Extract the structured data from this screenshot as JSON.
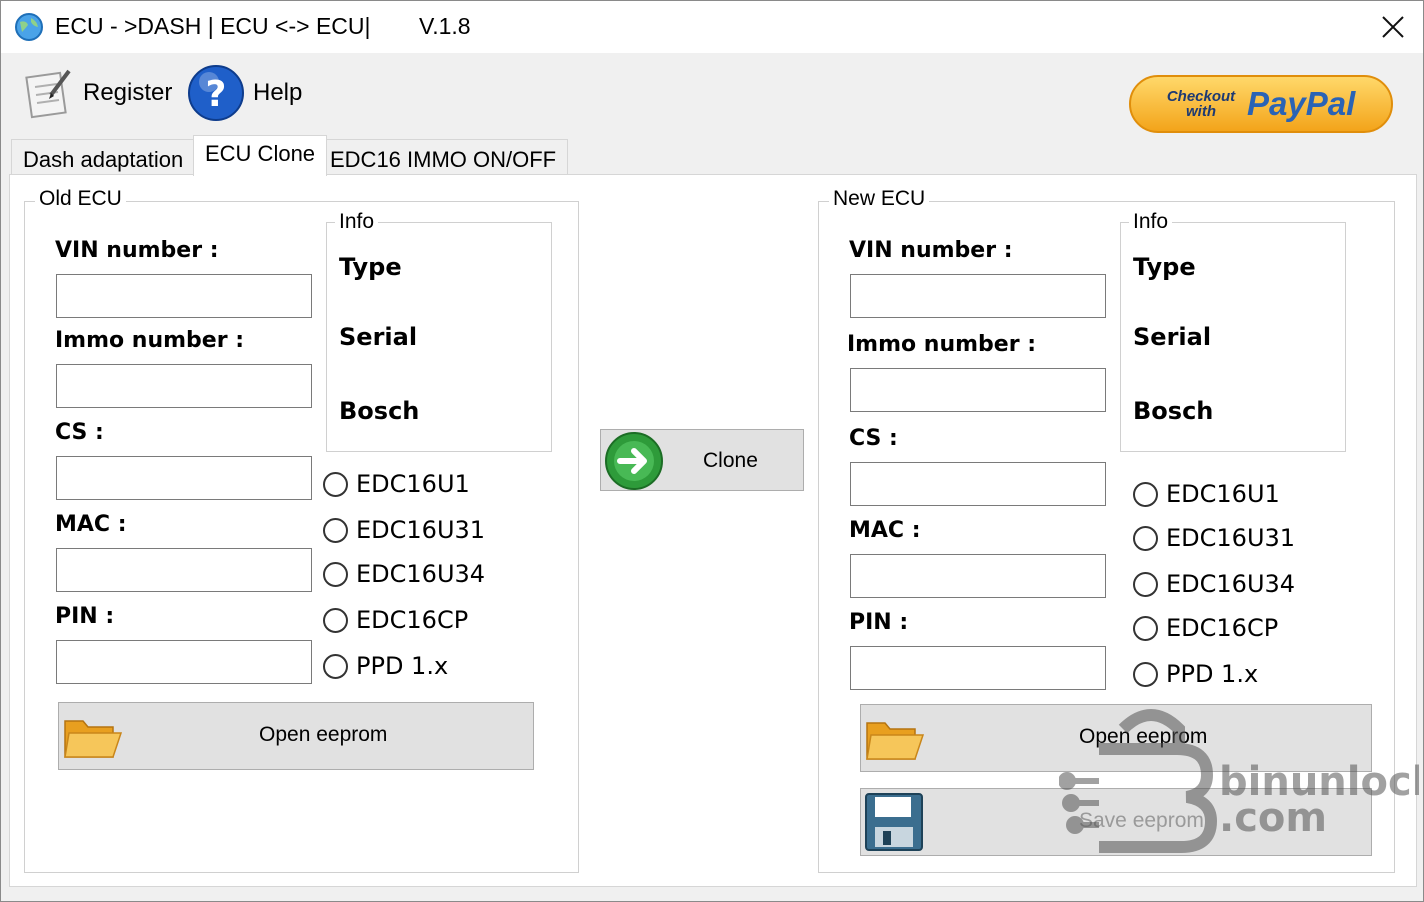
{
  "window": {
    "title": "ECU - >DASH | ECU <-> ECU|",
    "version": "V.1.8"
  },
  "toolbar": {
    "register_label": "Register",
    "help_label": "Help",
    "paypal_checkout": "Checkout with",
    "paypal_brand": "PayPal"
  },
  "tabs": [
    {
      "label": "Dash adaptation",
      "active": false
    },
    {
      "label": "ECU Clone",
      "active": true
    },
    {
      "label": "EDC16 IMMO ON/OFF",
      "active": false
    }
  ],
  "old_ecu": {
    "group_title": "Old ECU",
    "vin_label": "VIN number :",
    "immo_label": "Immo number :",
    "cs_label": "CS :",
    "mac_label": "MAC :",
    "pin_label": "PIN :",
    "vin_value": "",
    "immo_value": "",
    "cs_value": "",
    "mac_value": "",
    "pin_value": "",
    "info_title": "Info",
    "info_type": "Type",
    "info_serial": "Serial",
    "info_bosch": "Bosch",
    "radios": [
      "EDC16U1",
      "EDC16U31",
      "EDC16U34",
      "EDC16CP",
      "PPD 1.x"
    ],
    "open_eeprom_label": "Open eeprom"
  },
  "clone_button_label": "Clone",
  "new_ecu": {
    "group_title": "New ECU",
    "vin_label": "VIN number :",
    "immo_label": "Immo number :",
    "cs_label": "CS :",
    "mac_label": "MAC :",
    "pin_label": "PIN :",
    "vin_value": "",
    "immo_value": "",
    "cs_value": "",
    "mac_value": "",
    "pin_value": "",
    "info_title": "Info",
    "info_type": "Type",
    "info_serial": "Serial",
    "info_bosch": "Bosch",
    "radios": [
      "EDC16U1",
      "EDC16U31",
      "EDC16U34",
      "EDC16CP",
      "PPD 1.x"
    ],
    "open_eeprom_label": "Open eeprom",
    "save_eeprom_label": "Save eeprom"
  },
  "watermark": {
    "line1": "binunlock",
    "line2": ".com"
  },
  "colors": {
    "clone_arrow": "#2e9b3a",
    "help_icon": "#1f5fc9",
    "folder": "#f2b338",
    "paypal_gold": "#f3a41a",
    "paypal_blue": "#2a63b5"
  }
}
